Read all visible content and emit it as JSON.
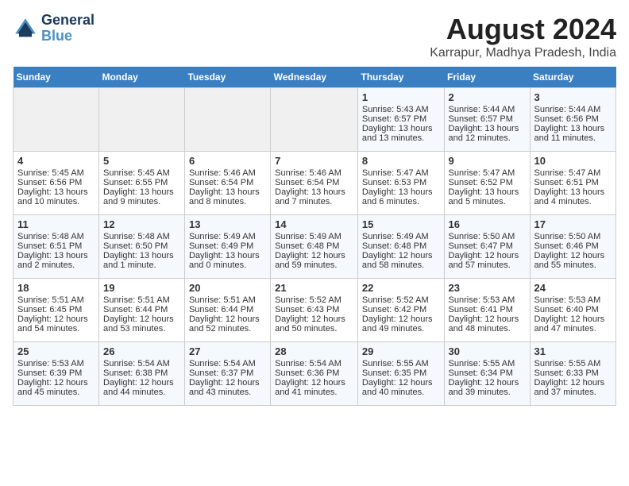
{
  "header": {
    "logo_line1": "General",
    "logo_line2": "Blue",
    "month_title": "August 2024",
    "location": "Karrapur, Madhya Pradesh, India"
  },
  "days_of_week": [
    "Sunday",
    "Monday",
    "Tuesday",
    "Wednesday",
    "Thursday",
    "Friday",
    "Saturday"
  ],
  "weeks": [
    [
      {
        "day": "",
        "text": ""
      },
      {
        "day": "",
        "text": ""
      },
      {
        "day": "",
        "text": ""
      },
      {
        "day": "",
        "text": ""
      },
      {
        "day": "1",
        "text": "Sunrise: 5:43 AM\nSunset: 6:57 PM\nDaylight: 13 hours\nand 13 minutes."
      },
      {
        "day": "2",
        "text": "Sunrise: 5:44 AM\nSunset: 6:57 PM\nDaylight: 13 hours\nand 12 minutes."
      },
      {
        "day": "3",
        "text": "Sunrise: 5:44 AM\nSunset: 6:56 PM\nDaylight: 13 hours\nand 11 minutes."
      }
    ],
    [
      {
        "day": "4",
        "text": "Sunrise: 5:45 AM\nSunset: 6:56 PM\nDaylight: 13 hours\nand 10 minutes."
      },
      {
        "day": "5",
        "text": "Sunrise: 5:45 AM\nSunset: 6:55 PM\nDaylight: 13 hours\nand 9 minutes."
      },
      {
        "day": "6",
        "text": "Sunrise: 5:46 AM\nSunset: 6:54 PM\nDaylight: 13 hours\nand 8 minutes."
      },
      {
        "day": "7",
        "text": "Sunrise: 5:46 AM\nSunset: 6:54 PM\nDaylight: 13 hours\nand 7 minutes."
      },
      {
        "day": "8",
        "text": "Sunrise: 5:47 AM\nSunset: 6:53 PM\nDaylight: 13 hours\nand 6 minutes."
      },
      {
        "day": "9",
        "text": "Sunrise: 5:47 AM\nSunset: 6:52 PM\nDaylight: 13 hours\nand 5 minutes."
      },
      {
        "day": "10",
        "text": "Sunrise: 5:47 AM\nSunset: 6:51 PM\nDaylight: 13 hours\nand 4 minutes."
      }
    ],
    [
      {
        "day": "11",
        "text": "Sunrise: 5:48 AM\nSunset: 6:51 PM\nDaylight: 13 hours\nand 2 minutes."
      },
      {
        "day": "12",
        "text": "Sunrise: 5:48 AM\nSunset: 6:50 PM\nDaylight: 13 hours\nand 1 minute."
      },
      {
        "day": "13",
        "text": "Sunrise: 5:49 AM\nSunset: 6:49 PM\nDaylight: 13 hours\nand 0 minutes."
      },
      {
        "day": "14",
        "text": "Sunrise: 5:49 AM\nSunset: 6:48 PM\nDaylight: 12 hours\nand 59 minutes."
      },
      {
        "day": "15",
        "text": "Sunrise: 5:49 AM\nSunset: 6:48 PM\nDaylight: 12 hours\nand 58 minutes."
      },
      {
        "day": "16",
        "text": "Sunrise: 5:50 AM\nSunset: 6:47 PM\nDaylight: 12 hours\nand 57 minutes."
      },
      {
        "day": "17",
        "text": "Sunrise: 5:50 AM\nSunset: 6:46 PM\nDaylight: 12 hours\nand 55 minutes."
      }
    ],
    [
      {
        "day": "18",
        "text": "Sunrise: 5:51 AM\nSunset: 6:45 PM\nDaylight: 12 hours\nand 54 minutes."
      },
      {
        "day": "19",
        "text": "Sunrise: 5:51 AM\nSunset: 6:44 PM\nDaylight: 12 hours\nand 53 minutes."
      },
      {
        "day": "20",
        "text": "Sunrise: 5:51 AM\nSunset: 6:44 PM\nDaylight: 12 hours\nand 52 minutes."
      },
      {
        "day": "21",
        "text": "Sunrise: 5:52 AM\nSunset: 6:43 PM\nDaylight: 12 hours\nand 50 minutes."
      },
      {
        "day": "22",
        "text": "Sunrise: 5:52 AM\nSunset: 6:42 PM\nDaylight: 12 hours\nand 49 minutes."
      },
      {
        "day": "23",
        "text": "Sunrise: 5:53 AM\nSunset: 6:41 PM\nDaylight: 12 hours\nand 48 minutes."
      },
      {
        "day": "24",
        "text": "Sunrise: 5:53 AM\nSunset: 6:40 PM\nDaylight: 12 hours\nand 47 minutes."
      }
    ],
    [
      {
        "day": "25",
        "text": "Sunrise: 5:53 AM\nSunset: 6:39 PM\nDaylight: 12 hours\nand 45 minutes."
      },
      {
        "day": "26",
        "text": "Sunrise: 5:54 AM\nSunset: 6:38 PM\nDaylight: 12 hours\nand 44 minutes."
      },
      {
        "day": "27",
        "text": "Sunrise: 5:54 AM\nSunset: 6:37 PM\nDaylight: 12 hours\nand 43 minutes."
      },
      {
        "day": "28",
        "text": "Sunrise: 5:54 AM\nSunset: 6:36 PM\nDaylight: 12 hours\nand 41 minutes."
      },
      {
        "day": "29",
        "text": "Sunrise: 5:55 AM\nSunset: 6:35 PM\nDaylight: 12 hours\nand 40 minutes."
      },
      {
        "day": "30",
        "text": "Sunrise: 5:55 AM\nSunset: 6:34 PM\nDaylight: 12 hours\nand 39 minutes."
      },
      {
        "day": "31",
        "text": "Sunrise: 5:55 AM\nSunset: 6:33 PM\nDaylight: 12 hours\nand 37 minutes."
      }
    ]
  ]
}
